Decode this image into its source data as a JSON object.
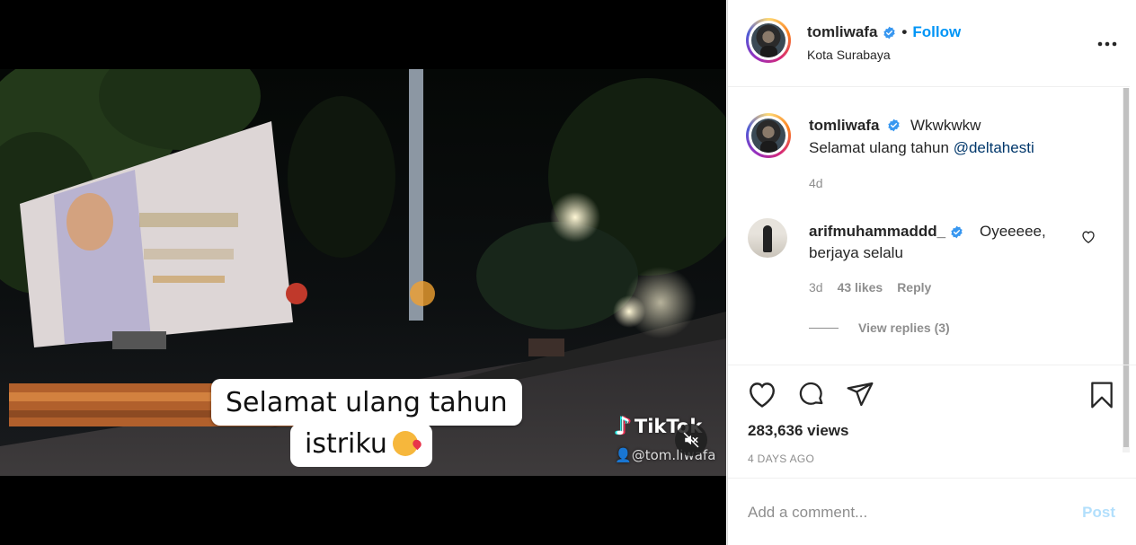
{
  "video": {
    "caption_line1": "Selamat ulang tahun",
    "caption_line2": "istriku",
    "watermark_brand": "TikTok",
    "watermark_handle": "@tom.liwafa"
  },
  "header": {
    "username": "tomliwafa",
    "separator": "•",
    "follow_label": "Follow",
    "location": "Kota Surabaya",
    "more_label": "•••"
  },
  "post_caption": {
    "username": "tomliwafa",
    "text_line1": "Wkwkwkw",
    "text_line2_prefix": "Selamat ulang tahun",
    "mention": "@deltahesti",
    "time": "4d"
  },
  "comment": {
    "username": "arifmuhammaddd_",
    "text_line1": "Oyeeeee,",
    "text_line2": "berjaya selalu",
    "time": "3d",
    "likes": "43 likes",
    "reply_label": "Reply",
    "view_replies": "View replies (3)"
  },
  "stats": {
    "views": "283,636 views",
    "posted": "4 DAYS AGO"
  },
  "composer": {
    "placeholder": "Add a comment...",
    "post_label": "Post"
  },
  "colors": {
    "accent": "#0095f6",
    "post_disabled": "#b2dffc",
    "verified": "#3897f0"
  }
}
